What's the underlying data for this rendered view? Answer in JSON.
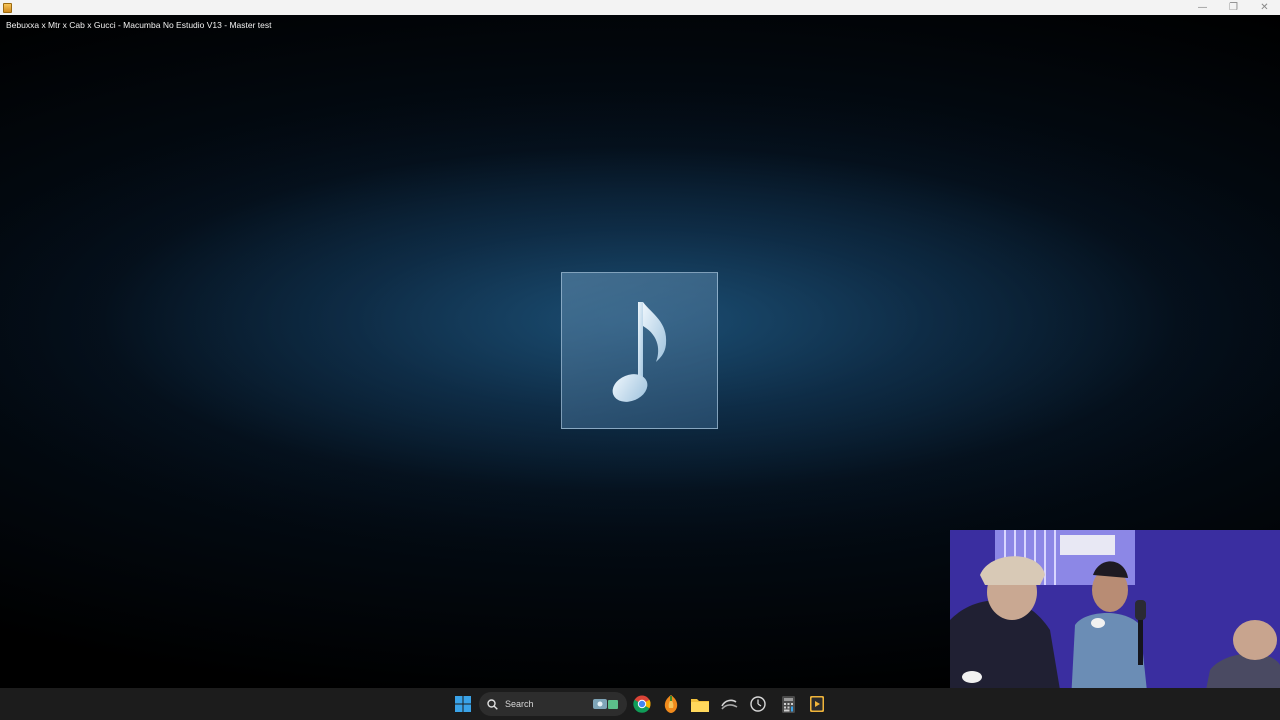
{
  "window": {
    "controls": {
      "minimize": "—",
      "restore": "❐",
      "close": "✕"
    }
  },
  "media": {
    "title": "Bebuxxa x Mtr x Cab x Gucci - Macumba No Estudio V13  - Master test",
    "artwork_icon": "music-note-icon"
  },
  "taskbar": {
    "search_label": "Search",
    "items": [
      "windows-start",
      "chrome",
      "fl-studio",
      "file-explorer",
      "snipping-tool",
      "clock",
      "calculator",
      "media-player"
    ]
  },
  "colors": {
    "taskbar": "#1c1c1c",
    "titlebar": "#f3f3f3",
    "accent": "#3aa3e8"
  }
}
